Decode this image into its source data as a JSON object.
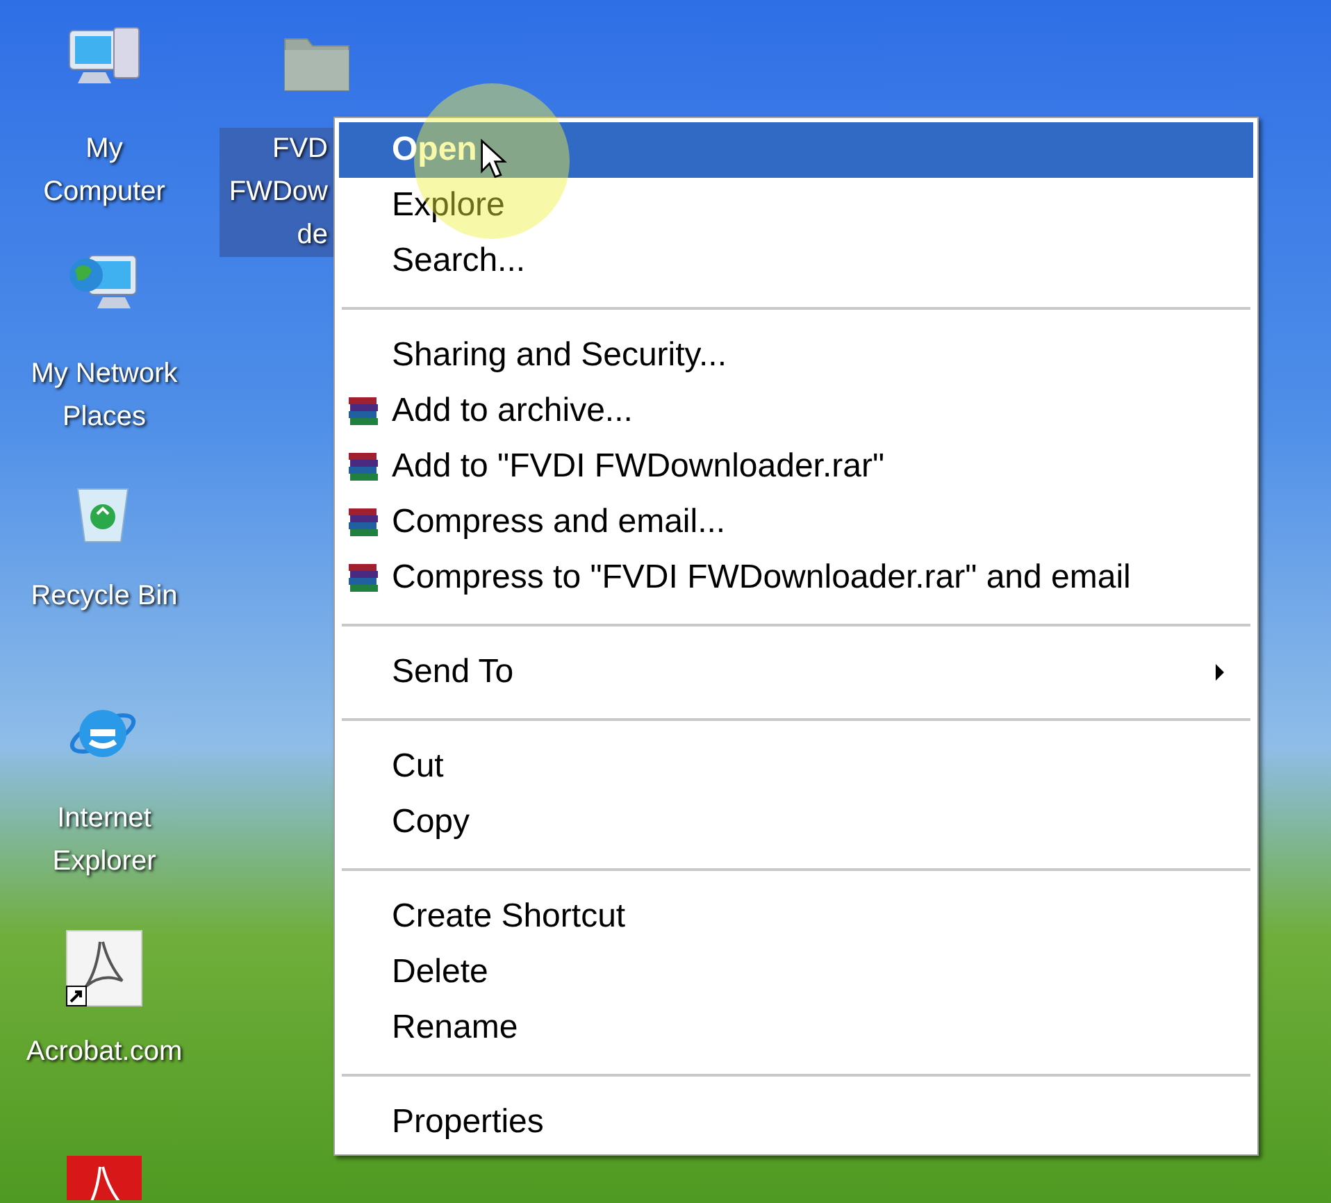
{
  "desktop_icons": [
    {
      "kind": "computer",
      "label_lines": [
        "My",
        "Computer"
      ],
      "selected": false,
      "shortcut": false
    },
    {
      "kind": "folder",
      "label_lines": [
        "FVD",
        "FWDow",
        "de"
      ],
      "selected": true,
      "shortcut": false
    },
    {
      "kind": "network",
      "label_lines": [
        "My Network",
        "Places"
      ],
      "selected": false,
      "shortcut": false
    },
    {
      "kind": "recycle",
      "label_lines": [
        "Recycle Bin"
      ],
      "selected": false,
      "shortcut": false
    },
    {
      "kind": "ie",
      "label_lines": [
        "Internet",
        "Explorer"
      ],
      "selected": false,
      "shortcut": false
    },
    {
      "kind": "acrobat",
      "label_lines": [
        "Acrobat.com"
      ],
      "selected": false,
      "shortcut": true
    },
    {
      "kind": "reader",
      "selected": false
    }
  ],
  "context_menu": {
    "items": [
      {
        "kind": "item",
        "label": "Open",
        "default": true,
        "selected": true,
        "archive_icon": false,
        "submenu": false
      },
      {
        "kind": "item",
        "label": "Explore",
        "default": false,
        "selected": false,
        "archive_icon": false,
        "submenu": false
      },
      {
        "kind": "item",
        "label": "Search...",
        "default": false,
        "selected": false,
        "archive_icon": false,
        "submenu": false
      },
      {
        "kind": "separator"
      },
      {
        "kind": "item",
        "label": "Sharing and Security...",
        "default": false,
        "selected": false,
        "archive_icon": false,
        "submenu": false
      },
      {
        "kind": "item",
        "label": "Add to archive...",
        "default": false,
        "selected": false,
        "archive_icon": true,
        "submenu": false
      },
      {
        "kind": "item",
        "label": "Add to \"FVDI FWDownloader.rar\"",
        "default": false,
        "selected": false,
        "archive_icon": true,
        "submenu": false
      },
      {
        "kind": "item",
        "label": "Compress and email...",
        "default": false,
        "selected": false,
        "archive_icon": true,
        "submenu": false
      },
      {
        "kind": "item",
        "label": "Compress to \"FVDI FWDownloader.rar\" and email",
        "default": false,
        "selected": false,
        "archive_icon": true,
        "submenu": false
      },
      {
        "kind": "separator"
      },
      {
        "kind": "item",
        "label": "Send To",
        "default": false,
        "selected": false,
        "archive_icon": false,
        "submenu": true
      },
      {
        "kind": "separator"
      },
      {
        "kind": "item",
        "label": "Cut",
        "default": false,
        "selected": false,
        "archive_icon": false,
        "submenu": false
      },
      {
        "kind": "item",
        "label": "Copy",
        "default": false,
        "selected": false,
        "archive_icon": false,
        "submenu": false
      },
      {
        "kind": "separator"
      },
      {
        "kind": "item",
        "label": "Create Shortcut",
        "default": false,
        "selected": false,
        "archive_icon": false,
        "submenu": false
      },
      {
        "kind": "item",
        "label": "Delete",
        "default": false,
        "selected": false,
        "archive_icon": false,
        "submenu": false
      },
      {
        "kind": "item",
        "label": "Rename",
        "default": false,
        "selected": false,
        "archive_icon": false,
        "submenu": false
      },
      {
        "kind": "separator"
      },
      {
        "kind": "item",
        "label": "Properties",
        "default": false,
        "selected": false,
        "archive_icon": false,
        "submenu": false
      }
    ]
  }
}
